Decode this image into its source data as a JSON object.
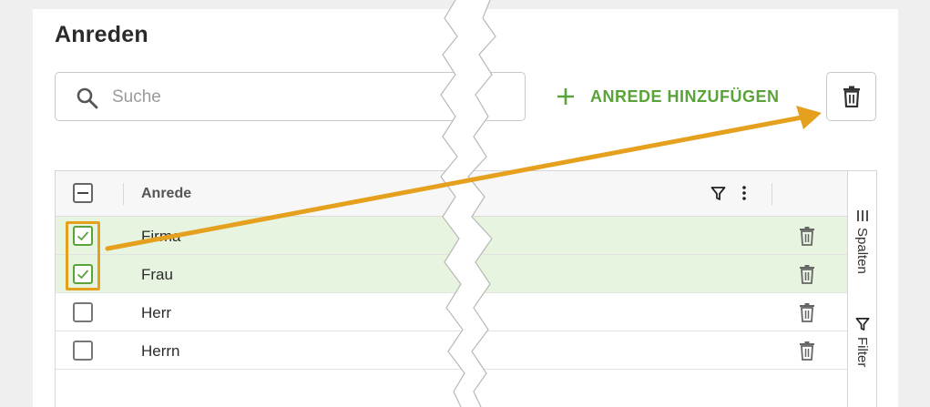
{
  "page": {
    "title": "Anreden"
  },
  "search": {
    "placeholder": "Suche"
  },
  "toolbar": {
    "add_label": "ANREDE HINZUFÜGEN",
    "accent_color": "#5aa33a"
  },
  "grid": {
    "column_header": "Anrede",
    "rows": [
      {
        "label": "Firma",
        "selected": true
      },
      {
        "label": "Frau",
        "selected": true
      },
      {
        "label": "Herr",
        "selected": false
      },
      {
        "label": "Herrn",
        "selected": false
      }
    ],
    "selected_row_color": "#e7f4e0"
  },
  "sidebar": {
    "columns_label": "Spalten",
    "filter_label": "Filter"
  },
  "annotation": {
    "color": "#e5a01e"
  },
  "icons": {
    "search": "search-icon",
    "plus": "plus-icon",
    "bulk_delete": "trash-icon",
    "row_delete": "trash-icon",
    "filter": "filter-icon",
    "menu": "more-vert-icon",
    "columns": "columns-icon"
  }
}
